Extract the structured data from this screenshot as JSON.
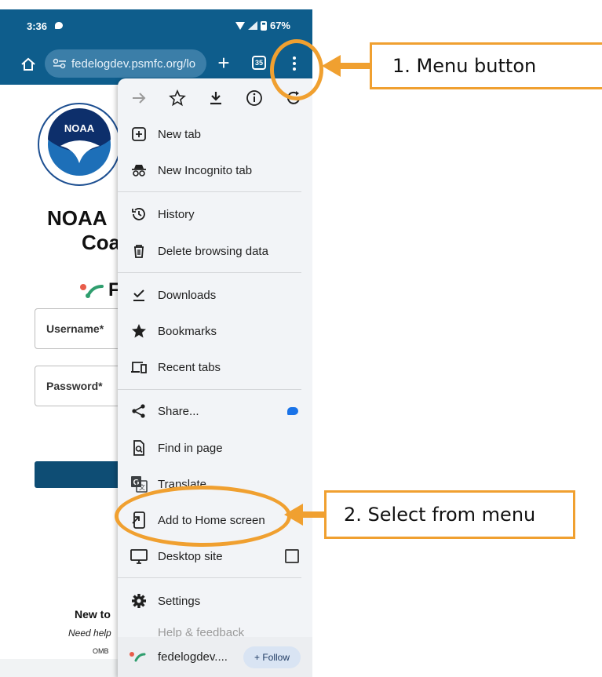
{
  "status_bar": {
    "time": "3:36",
    "battery": "67%"
  },
  "browser_toolbar": {
    "url": "fedelogdev.psmfc.org/lo",
    "tab_count": "35"
  },
  "page": {
    "heading_line1": "NOAA",
    "heading_line2": "Coa",
    "brand_letter": "F",
    "username_label": "Username*",
    "password_label": "Password*",
    "new_to": "New to",
    "need_help": "Need help",
    "omb": "OMB"
  },
  "menu": {
    "items": [
      {
        "label": "New tab",
        "icon": "plus-box-icon"
      },
      {
        "label": "New Incognito tab",
        "icon": "incognito-icon"
      },
      {
        "label": "History",
        "icon": "history-icon"
      },
      {
        "label": "Delete browsing data",
        "icon": "trash-icon"
      },
      {
        "label": "Downloads",
        "icon": "download-check-icon"
      },
      {
        "label": "Bookmarks",
        "icon": "star-filled-icon"
      },
      {
        "label": "Recent tabs",
        "icon": "devices-icon"
      },
      {
        "label": "Share...",
        "icon": "share-icon"
      },
      {
        "label": "Find in page",
        "icon": "find-in-page-icon"
      },
      {
        "label": "Translate",
        "icon": "translate-icon"
      },
      {
        "label": "Add to Home screen",
        "icon": "add-to-home-icon"
      },
      {
        "label": "Desktop site",
        "icon": "monitor-icon"
      },
      {
        "label": "Settings",
        "icon": "gear-icon"
      }
    ],
    "faded_item": "Help & feedback",
    "site_name": "fedelogdev....",
    "follow_label": "+ Follow"
  },
  "annotations": {
    "callout1": "1. Menu button",
    "callout2": "2. Select from menu",
    "color": "#f0a030"
  },
  "colors": {
    "toolbar": "#0e5d8c",
    "menu_bg": "#f2f4f7"
  }
}
